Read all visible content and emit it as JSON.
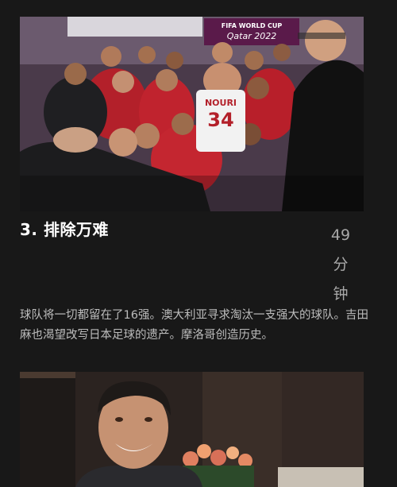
{
  "episode": {
    "thumbnail_name": "celebration-locker-room-image",
    "banner_text": "FIFA WORLD CUP",
    "banner_sub": "Qatar 2022",
    "jersey_name": "NOURI",
    "jersey_number": "34",
    "title": "3. 排除万难",
    "duration_number": "49",
    "duration_unit_1": "分",
    "duration_unit_2": "钟",
    "description": "球队将一切都留在了16强。澳大利亚寻求淘汰一支强大的球队。吉田麻也渴望改写日本足球的遗产。摩洛哥创造历史。"
  },
  "next_episode": {
    "thumbnail_name": "interview-portrait-image"
  }
}
